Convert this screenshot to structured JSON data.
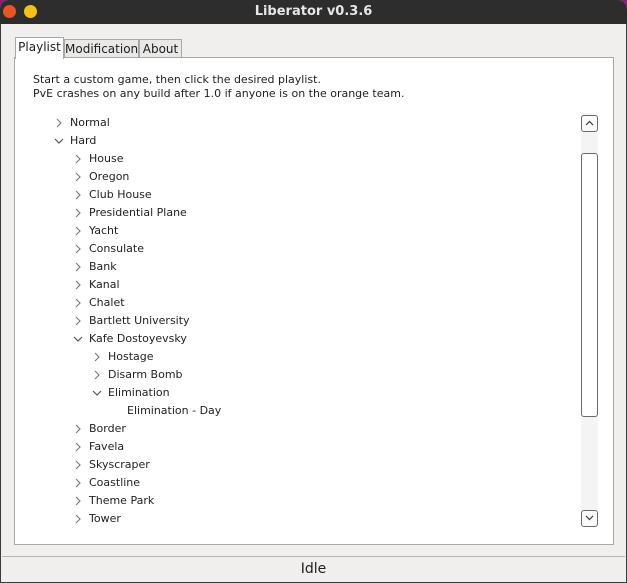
{
  "window": {
    "title": "Liberator v0.3.6",
    "close_color": "#e95420",
    "minimize_color": "#f5c211"
  },
  "tabs": [
    {
      "label": "Playlist",
      "active": true
    },
    {
      "label": "Modifications",
      "active": false
    },
    {
      "label": "About",
      "active": false
    }
  ],
  "description": {
    "line1": "Start a custom game, then click the desired playlist.",
    "line2": "PvE crashes on any build after 1.0 if anyone is on the orange team."
  },
  "tree": {
    "items": [
      {
        "label": "Normal",
        "level": 0,
        "arrow": "collapsed"
      },
      {
        "label": "Hard",
        "level": 0,
        "arrow": "expanded"
      },
      {
        "label": "House",
        "level": 1,
        "arrow": "collapsed"
      },
      {
        "label": "Oregon",
        "level": 1,
        "arrow": "collapsed"
      },
      {
        "label": "Club House",
        "level": 1,
        "arrow": "collapsed"
      },
      {
        "label": "Presidential Plane",
        "level": 1,
        "arrow": "collapsed"
      },
      {
        "label": "Yacht",
        "level": 1,
        "arrow": "collapsed"
      },
      {
        "label": "Consulate",
        "level": 1,
        "arrow": "collapsed"
      },
      {
        "label": "Bank",
        "level": 1,
        "arrow": "collapsed"
      },
      {
        "label": "Kanal",
        "level": 1,
        "arrow": "collapsed"
      },
      {
        "label": "Chalet",
        "level": 1,
        "arrow": "collapsed"
      },
      {
        "label": "Bartlett University",
        "level": 1,
        "arrow": "collapsed"
      },
      {
        "label": "Kafe Dostoyevsky",
        "level": 1,
        "arrow": "expanded"
      },
      {
        "label": "Hostage",
        "level": 2,
        "arrow": "collapsed"
      },
      {
        "label": "Disarm Bomb",
        "level": 2,
        "arrow": "collapsed"
      },
      {
        "label": "Elimination",
        "level": 2,
        "arrow": "expanded"
      },
      {
        "label": "Elimination - Day",
        "level": 3,
        "arrow": "none"
      },
      {
        "label": "Border",
        "level": 1,
        "arrow": "collapsed"
      },
      {
        "label": "Favela",
        "level": 1,
        "arrow": "collapsed"
      },
      {
        "label": "Skyscraper",
        "level": 1,
        "arrow": "collapsed"
      },
      {
        "label": "Coastline",
        "level": 1,
        "arrow": "collapsed"
      },
      {
        "label": "Theme Park",
        "level": 1,
        "arrow": "collapsed"
      },
      {
        "label": "Tower",
        "level": 1,
        "arrow": "collapsed"
      }
    ]
  },
  "status": {
    "text": "Idle"
  }
}
